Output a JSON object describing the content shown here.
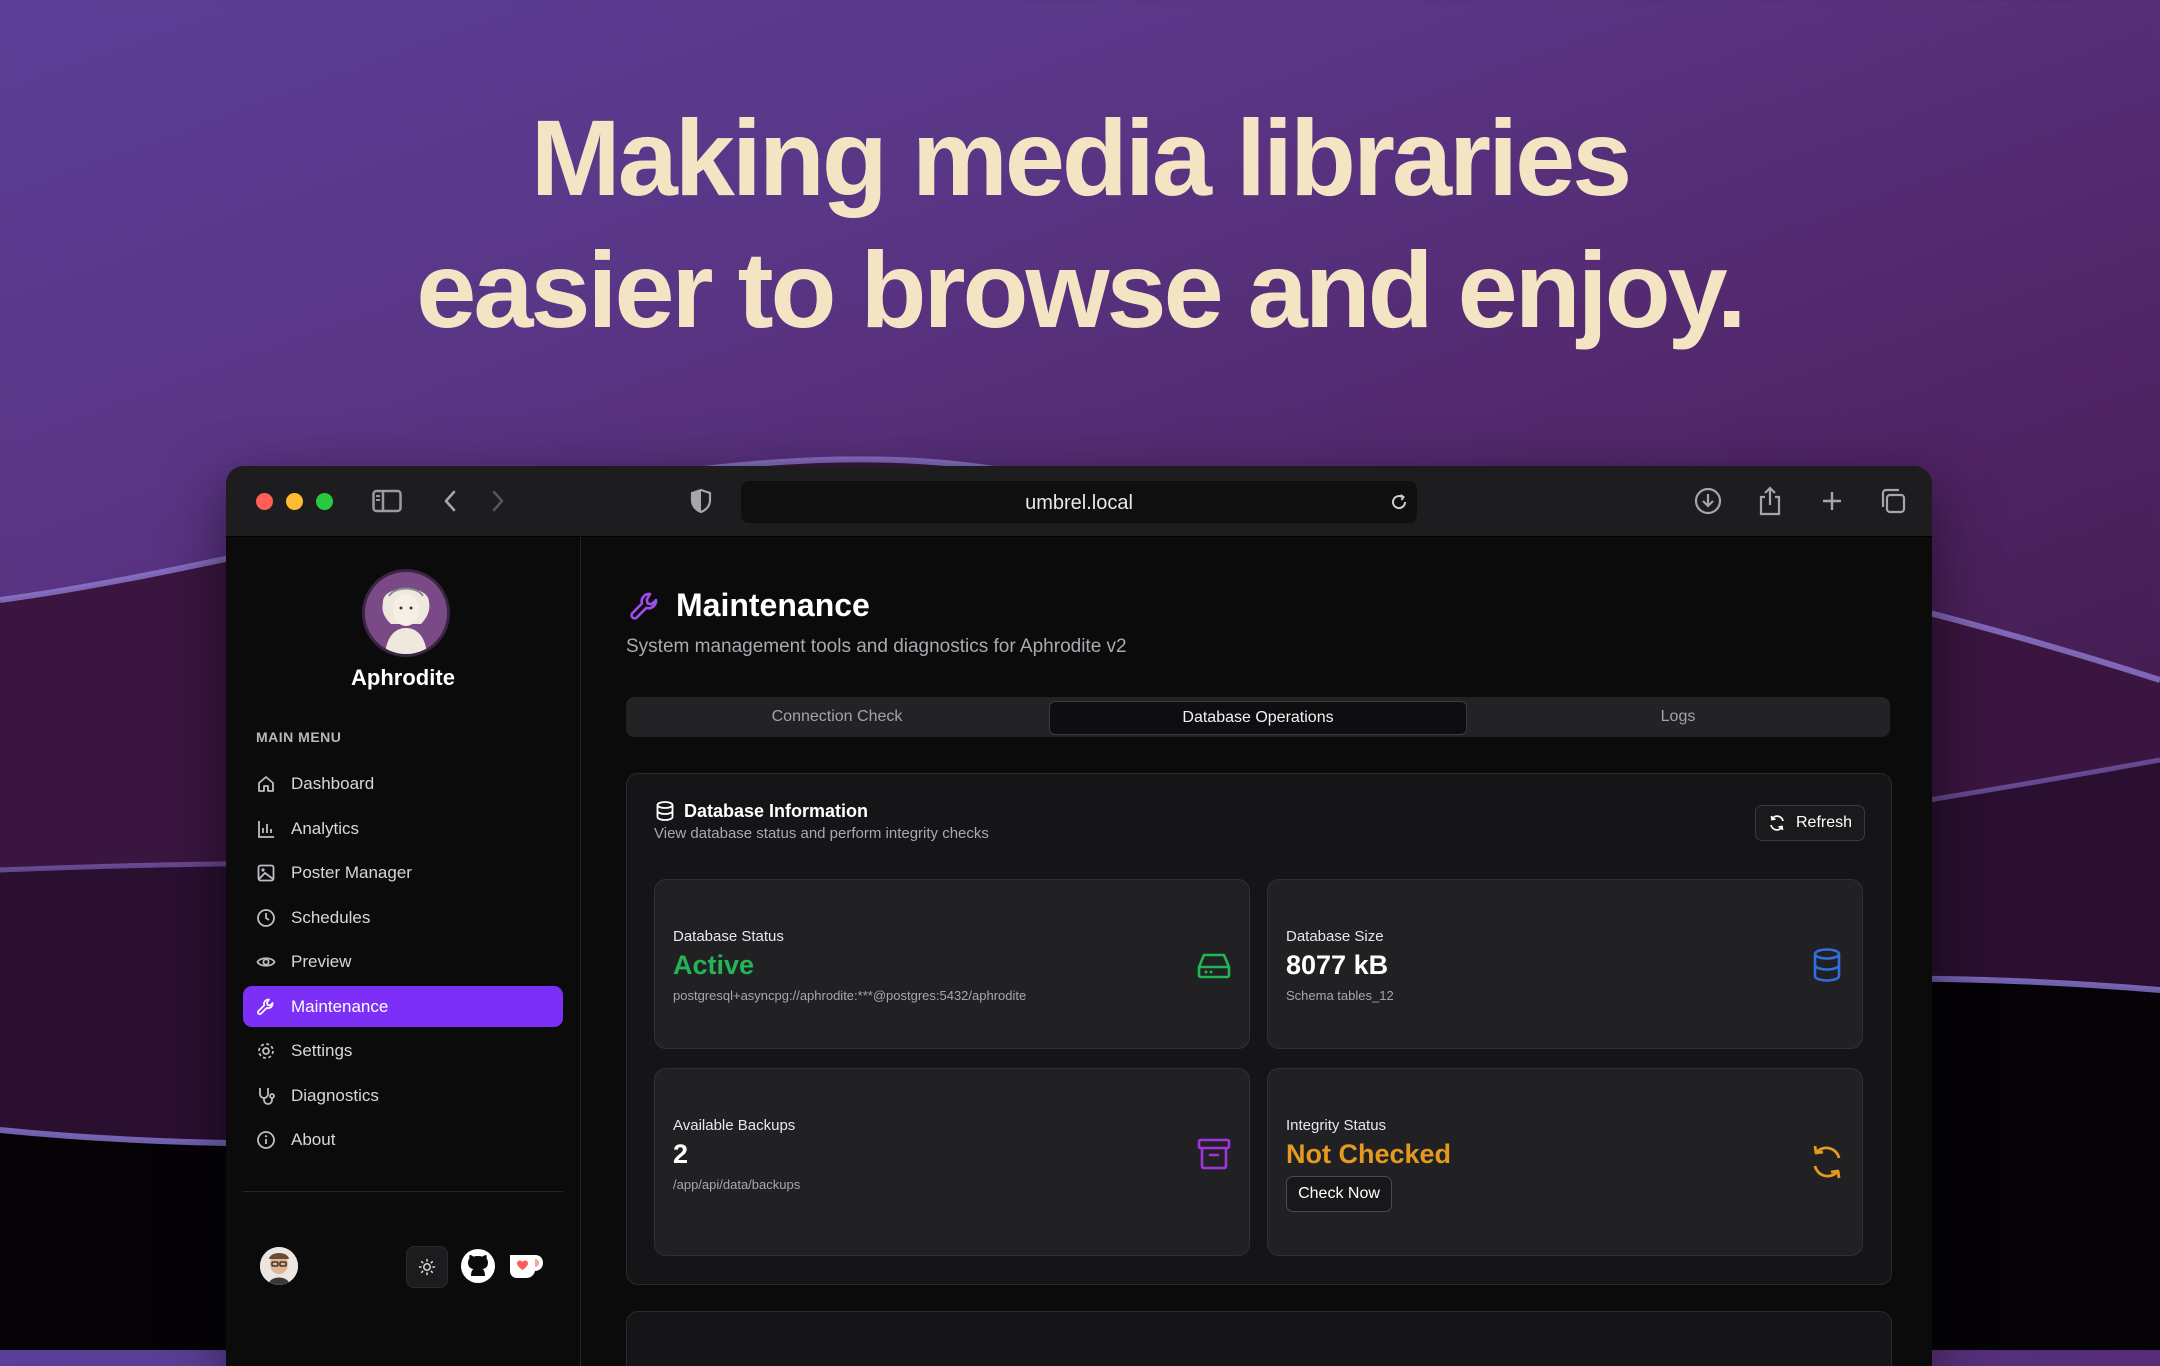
{
  "hero": {
    "line1": "Making media libraries",
    "line2": "easier to browse and enjoy."
  },
  "browser": {
    "url": "umbrel.local",
    "traffic_lights": [
      "#ff5f57",
      "#febc2e",
      "#28c840"
    ]
  },
  "sidebar": {
    "brand": "Aphrodite",
    "menu_title": "MAIN MENU",
    "items": [
      {
        "label": "Dashboard",
        "icon": "home-icon"
      },
      {
        "label": "Analytics",
        "icon": "bar-chart-icon"
      },
      {
        "label": "Poster Manager",
        "icon": "image-icon"
      },
      {
        "label": "Schedules",
        "icon": "clock-icon"
      },
      {
        "label": "Preview",
        "icon": "eye-icon"
      },
      {
        "label": "Maintenance",
        "icon": "wrench-icon",
        "active": true
      },
      {
        "label": "Settings",
        "icon": "gear-icon"
      },
      {
        "label": "Diagnostics",
        "icon": "stethoscope-icon"
      },
      {
        "label": "About",
        "icon": "info-icon"
      }
    ]
  },
  "main": {
    "title": "Maintenance",
    "subtitle": "System management tools and diagnostics for Aphrodite v2",
    "tabs": [
      {
        "label": "Connection Check"
      },
      {
        "label": "Database Operations",
        "active": true
      },
      {
        "label": "Logs"
      }
    ],
    "db_card": {
      "title": "Database Information",
      "subtitle": "View database status and perform integrity checks",
      "refresh_label": "Refresh",
      "status": {
        "label": "Database Status",
        "value": "Active",
        "detail": "postgresql+asyncpg://aphrodite:***@postgres:5432/aphrodite",
        "color": "#22b455"
      },
      "size": {
        "label": "Database Size",
        "value": "8077 kB",
        "detail": "Schema tables_12",
        "color": "#2f6fe0"
      },
      "backups": {
        "label": "Available Backups",
        "value": "2",
        "detail": "/app/api/data/backups",
        "color": "#a034e0"
      },
      "integrity": {
        "label": "Integrity Status",
        "value": "Not Checked",
        "button": "Check Now",
        "color": "#e59a1f"
      }
    }
  },
  "colors": {
    "accent": "#7b2ff7",
    "hero_text": "#f3e4c4"
  }
}
